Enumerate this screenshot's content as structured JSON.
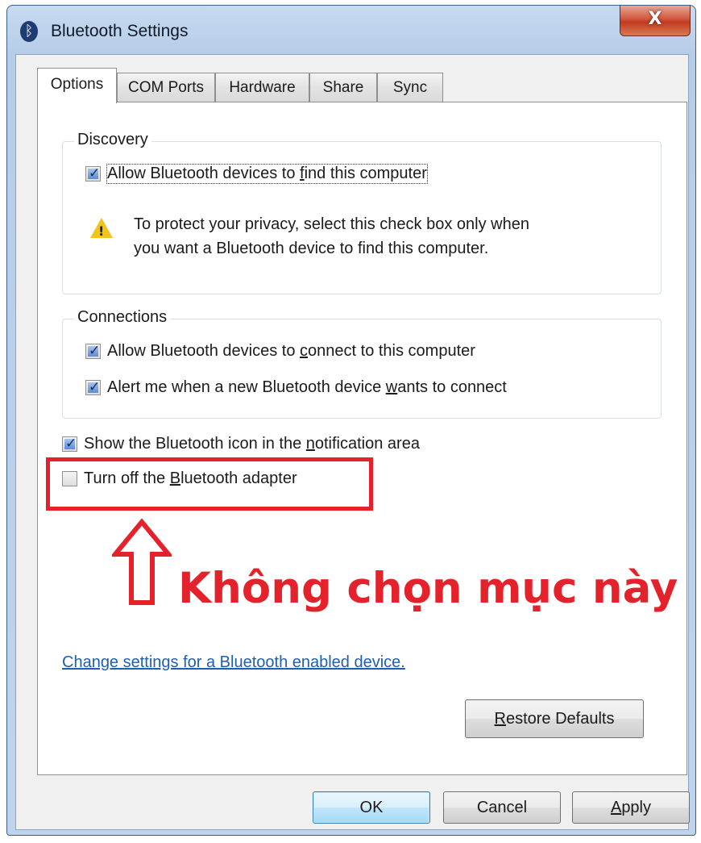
{
  "window": {
    "title": "Bluetooth Settings",
    "title_icon": "bluetooth-icon",
    "close_glyph": "X"
  },
  "tabs": [
    {
      "label": "Options",
      "active": true
    },
    {
      "label": "COM Ports",
      "active": false
    },
    {
      "label": "Hardware",
      "active": false
    },
    {
      "label": "Share",
      "active": false
    },
    {
      "label": "Sync",
      "active": false
    }
  ],
  "discovery": {
    "title": "Discovery",
    "allow_find": {
      "pre": "Allow Bluetooth devices to ",
      "key": "f",
      "post": "ind this computer",
      "checked": true
    },
    "warning_icon": "warning-icon",
    "warning_line1": "To protect your privacy, select this check box only when",
    "warning_line2": "you want a Bluetooth device to find this computer."
  },
  "connections": {
    "title": "Connections",
    "allow_connect": {
      "pre": "Allow Bluetooth devices to ",
      "key": "c",
      "post": "onnect to this computer",
      "checked": true
    },
    "alert_new": {
      "pre": "Alert me when a new Bluetooth device ",
      "key": "w",
      "post": "ants to connect",
      "checked": true
    }
  },
  "show_icon": {
    "pre": "Show the Bluetooth icon in the ",
    "key": "n",
    "post": "otification area",
    "checked": true
  },
  "turn_off": {
    "pre": "Turn off the ",
    "key": "B",
    "post": "luetooth adapter",
    "checked": false
  },
  "annotation": {
    "text": "Không chọn mục này",
    "color": "#e4222c"
  },
  "link": {
    "text": "Change settings for a Bluetooth enabled device."
  },
  "restore": {
    "key": "R",
    "post": "estore Defaults"
  },
  "buttons": {
    "ok": "OK",
    "cancel": "Cancel",
    "apply": {
      "key": "A",
      "post": "pply"
    }
  }
}
